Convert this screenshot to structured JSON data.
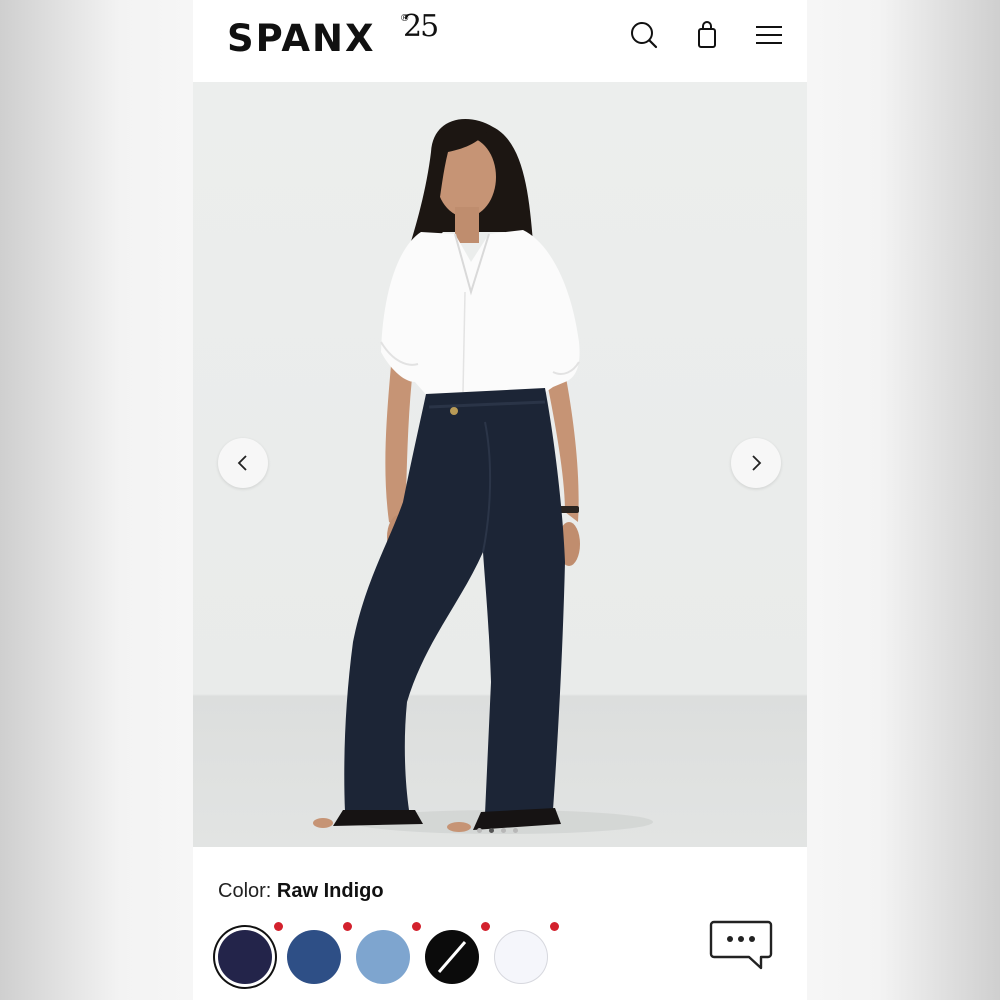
{
  "brand": {
    "name": "SPANX",
    "registered": "®",
    "anniversary": "25"
  },
  "header": {
    "icons": [
      "search-icon",
      "shopping-bag-icon",
      "menu-icon"
    ]
  },
  "hero": {
    "image": "model-in-white-shirt-and-raw-indigo-flare-jeans",
    "prev_icon": "chevron-left-icon",
    "next_icon": "chevron-right-icon",
    "slides_total": 4,
    "slide_active": 2
  },
  "product": {
    "color_label": "Color:",
    "color_value": "Raw Indigo",
    "swatches": [
      {
        "name": "Raw Indigo",
        "color": "#23244a",
        "selected": true
      },
      {
        "name": "Medium Blue",
        "color": "#2e4f86",
        "selected": false
      },
      {
        "name": "Light Blue",
        "color": "#7ea5cf",
        "selected": false
      },
      {
        "name": "Black",
        "color": "#0b0b0b",
        "selected": false
      },
      {
        "name": "White",
        "color": "#f5f6fb",
        "selected": false
      }
    ],
    "sale_indicator_color": "#d3212d"
  },
  "chat": {
    "icon": "chat-bubble-icon"
  }
}
